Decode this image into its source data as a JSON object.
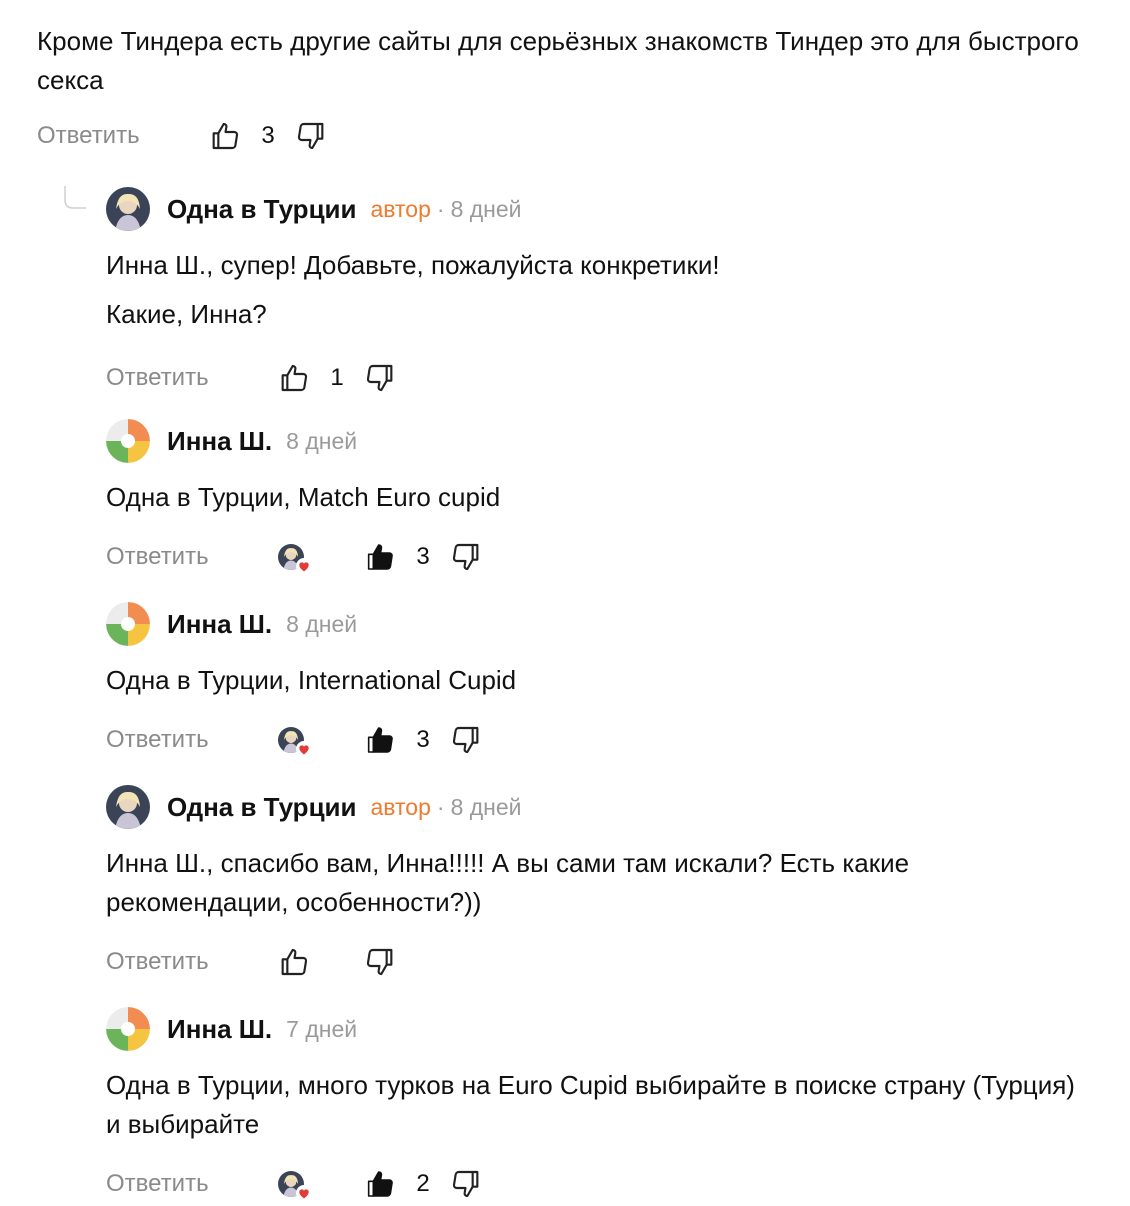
{
  "top_comment": {
    "text": "Кроме Тиндера есть другие сайты для серьёзных знакомств Тиндер это для быстрого секса",
    "reply_label": "Ответить",
    "likes": "3"
  },
  "replies": [
    {
      "author": "Одна в Турции",
      "author_tag": "автор",
      "separator": "·",
      "date": "8 дней",
      "lines": [
        "Инна Ш., супер! Добавьте, пожалуйста конкретики!",
        "Какие, Инна?"
      ],
      "reply_label": "Ответить",
      "likes": "1"
    },
    {
      "author": "Инна Ш.",
      "date": "8 дней",
      "text": "Одна в Турции, Match Euro cupid",
      "reply_label": "Ответить",
      "likes": "3"
    },
    {
      "author": "Инна Ш.",
      "date": "8 дней",
      "text": "Одна в Турции, International Cupid",
      "reply_label": "Ответить",
      "likes": "3"
    },
    {
      "author": "Одна в Турции",
      "author_tag": "автор",
      "separator": "·",
      "date": "8 дней",
      "text": "Инна Ш., спасибо вам, Инна!!!!! А вы сами там искали? Есть какие рекомендации, особенности?))",
      "reply_label": "Ответить",
      "likes": ""
    },
    {
      "author": "Инна Ш.",
      "date": "7 дней",
      "text": "Одна в Турции, много турков на Euro Cupid выбирайте в поиске страну (Турция) и выбирайте",
      "reply_label": "Ответить",
      "likes": "2"
    }
  ],
  "icons": {
    "like": "thumbs-up-icon",
    "dislike": "thumbs-down-icon",
    "liked_by_author": "heart-icon"
  },
  "colors": {
    "author_tag": "#f07a2e",
    "muted": "#8a8a8a",
    "heart": "#e23b3b"
  }
}
